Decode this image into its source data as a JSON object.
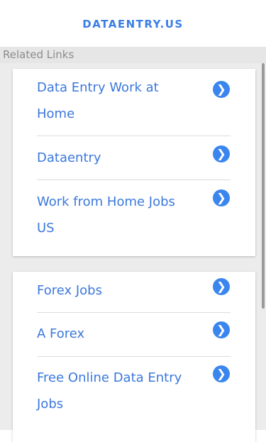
{
  "header": {
    "title": "DATAENTRY.US"
  },
  "section": {
    "label": "Related Links"
  },
  "cards": [
    {
      "items": [
        {
          "label": "Data Entry Work at Home"
        },
        {
          "label": "Dataentry"
        },
        {
          "label": "Work from Home Jobs US"
        }
      ]
    },
    {
      "items": [
        {
          "label": "Forex Jobs"
        },
        {
          "label": "A Forex"
        },
        {
          "label": "Free Online Data Entry Jobs"
        }
      ]
    }
  ],
  "icons": {
    "chevron": "chevron-right-icon",
    "chevron_glyph": "❯"
  },
  "colors": {
    "accent": "#3a7ee4",
    "link": "#3b78dc",
    "chevron_bg": "#3a86ee",
    "section_bar": "#e6e6e6",
    "page_bg": "#ececec"
  }
}
